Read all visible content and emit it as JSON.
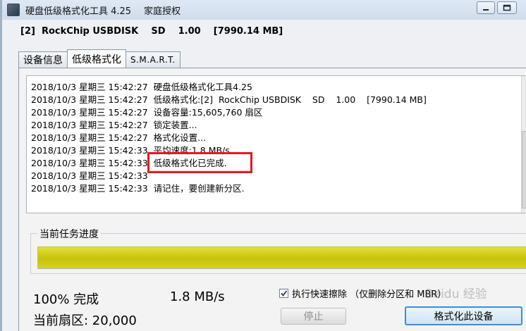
{
  "window": {
    "title": "硬盘低级格式化工具 4.25",
    "license": "家庭授权"
  },
  "device": {
    "line": "[2]  RockChip USBDISK    SD    1.00    [7990.14 MB]"
  },
  "tabs": [
    {
      "label": "设备信息",
      "active": false
    },
    {
      "label": "低级格式化",
      "active": true
    },
    {
      "label": "S.M.A.R.T.",
      "active": false
    }
  ],
  "log": [
    "2018/10/3 星期三 15:42:27  硬盘低级格式化工具4.25",
    "2018/10/3 星期三 15:42:27  低级格式化:[2]  RockChip USBDISK    SD    1.00    [7990.14 MB]",
    "2018/10/3 星期三 15:42:27  设备容量:15,605,760 扇区",
    "2018/10/3 星期三 15:42:27  锁定装置...",
    "2018/10/3 星期三 15:42:27  格式化设置...",
    "2018/10/3 星期三 15:42:33  平均速度:1.8 MB/s",
    "2018/10/3 星期三 15:42:33  低级格式化已完成.",
    "2018/10/3 星期三 15:42:33",
    "2018/10/3 星期三 15:42:33  请记住，要创建新分区."
  ],
  "progress": {
    "label": "当前任务进度",
    "fraction": 1.0,
    "color": "#d4d01a"
  },
  "stats": {
    "percent": "100% 完成",
    "speed": "1.8 MB/s",
    "sector": "当前扇区: 20,000"
  },
  "options": {
    "quick_wipe": "执行快速擦除 （仅删除分区和 MBR）",
    "quick_wipe_checked": true
  },
  "buttons": {
    "stop": "停止",
    "format": "格式化此设备"
  },
  "watermark": "Baidu 经验"
}
